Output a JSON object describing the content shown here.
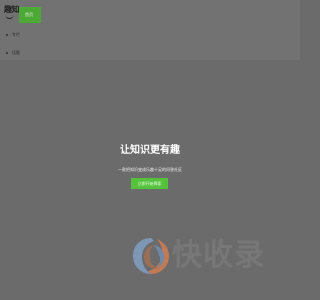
{
  "header": {
    "logo_text": "趣知",
    "nav_active_label": "首页",
    "nav_items": [
      {
        "label": "专栏"
      },
      {
        "label": "话题"
      }
    ]
  },
  "hero": {
    "title": "让知识更有趣",
    "subtitle": "一款把知识变成乐趣十足的问答社区",
    "cta_label": "立即开始探索"
  },
  "watermark": {
    "text": "快收录"
  },
  "colors": {
    "background": "#6b6b6b",
    "header": "#727272",
    "accent_green": "#54c23a",
    "nav_active_green": "#4da935"
  },
  "icons": {
    "logo": "smile-logo-icon",
    "watermark": "swirl-logo-icon"
  }
}
